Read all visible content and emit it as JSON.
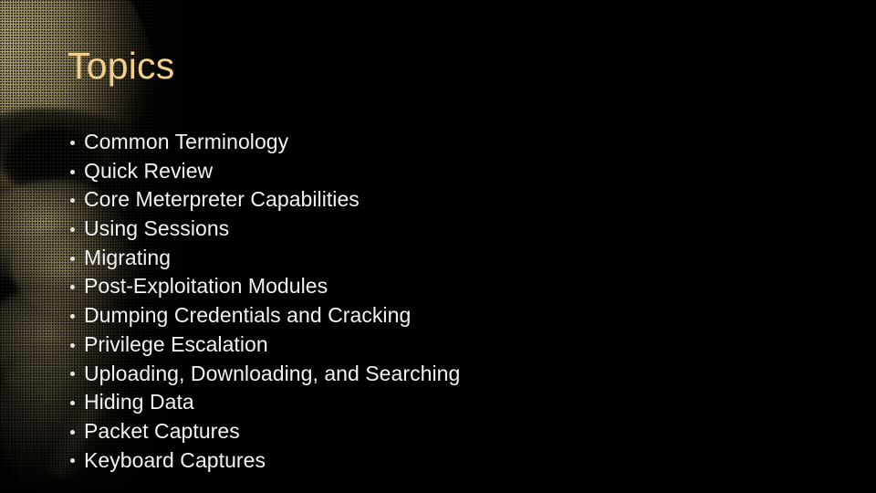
{
  "slide": {
    "title": "Topics",
    "background_color": "#000000",
    "title_color": "#f3cf8a",
    "body_text_color": "#f2f2f2",
    "bullet_marker_color": "#e6e6e6",
    "artwork_tint": "#9a8f66",
    "artwork_name": "halftone-skull-left-edge"
  },
  "bullets": [
    {
      "label": "Common Terminology"
    },
    {
      "label": "Quick Review"
    },
    {
      "label": "Core Meterpreter Capabilities"
    },
    {
      "label": "Using Sessions"
    },
    {
      "label": "Migrating"
    },
    {
      "label": "Post-Exploitation Modules"
    },
    {
      "label": "Dumping Credentials and Cracking"
    },
    {
      "label": "Privilege Escalation"
    },
    {
      "label": "Uploading, Downloading, and Searching"
    },
    {
      "label": "Hiding Data"
    },
    {
      "label": "Packet Captures"
    },
    {
      "label": "Keyboard Captures"
    }
  ]
}
